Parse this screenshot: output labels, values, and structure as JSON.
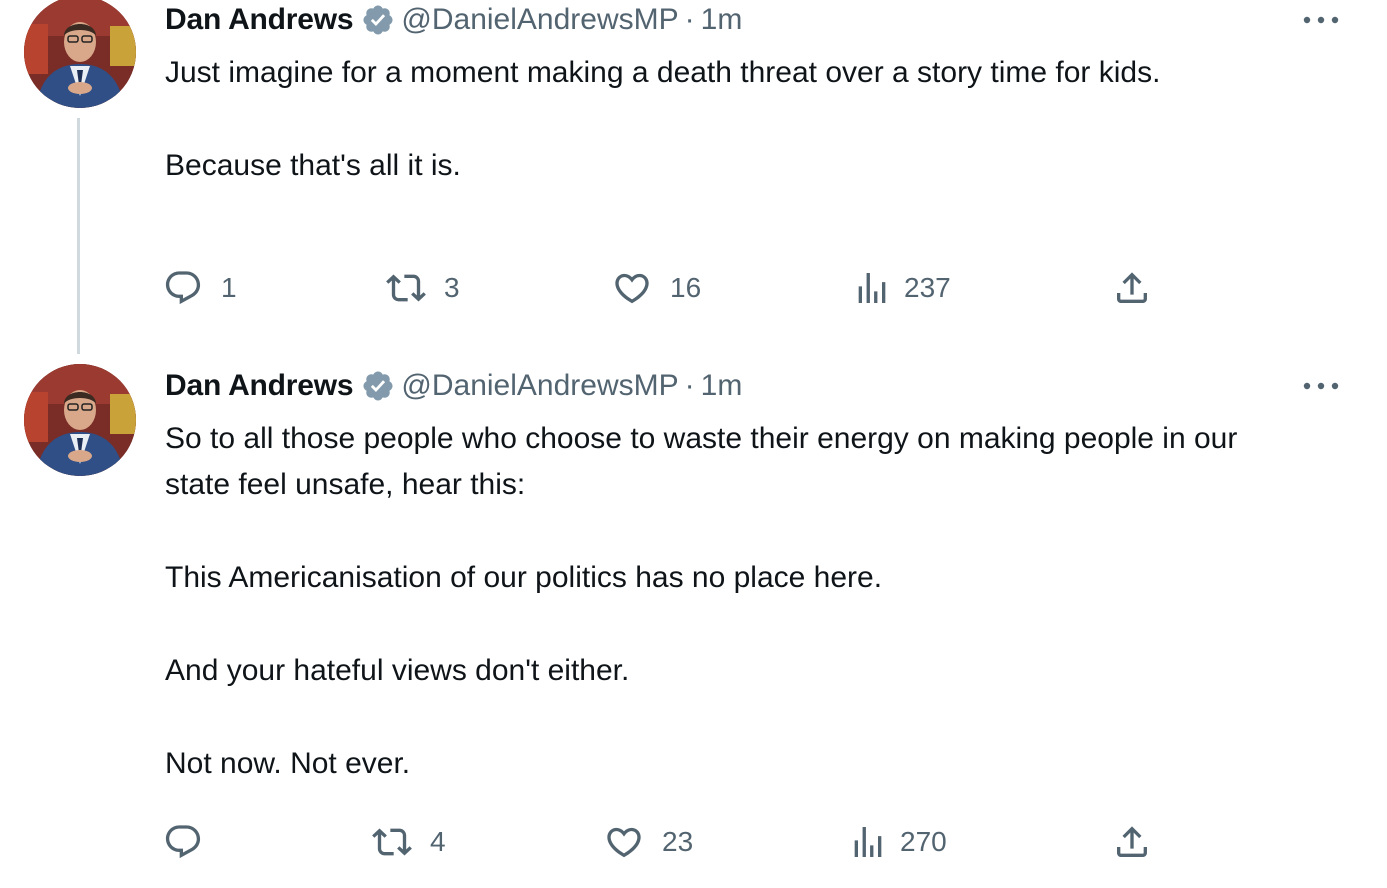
{
  "tweets": [
    {
      "author_name": "Dan Andrews",
      "handle": "@DanielAndrewsMP",
      "separator": "·",
      "time": "1m",
      "paragraphs": [
        "Just imagine for a moment making a death threat over a story time for kids.",
        "Because that's all it is."
      ],
      "replies": "1",
      "retweets": "3",
      "likes": "16",
      "views": "237"
    },
    {
      "author_name": "Dan Andrews",
      "handle": "@DanielAndrewsMP",
      "separator": "·",
      "time": "1m",
      "paragraphs": [
        "So to all those people who choose to waste their energy on making people in our state feel unsafe, hear this:",
        "This Americanisation of our politics has no place here.",
        "And your hateful views don't either.",
        "Not now. Not ever."
      ],
      "replies": "",
      "retweets": "4",
      "likes": "23",
      "views": "270"
    }
  ],
  "icons": {
    "reply": "reply-icon",
    "retweet": "retweet-icon",
    "like": "heart-icon",
    "views": "views-icon",
    "share": "share-icon",
    "more": "more-icon",
    "verified": "verified-badge-icon"
  },
  "colors": {
    "text": "#0f1419",
    "secondary": "#536471",
    "verified_badge": "#829aab",
    "thread_line": "#cfd9de"
  }
}
